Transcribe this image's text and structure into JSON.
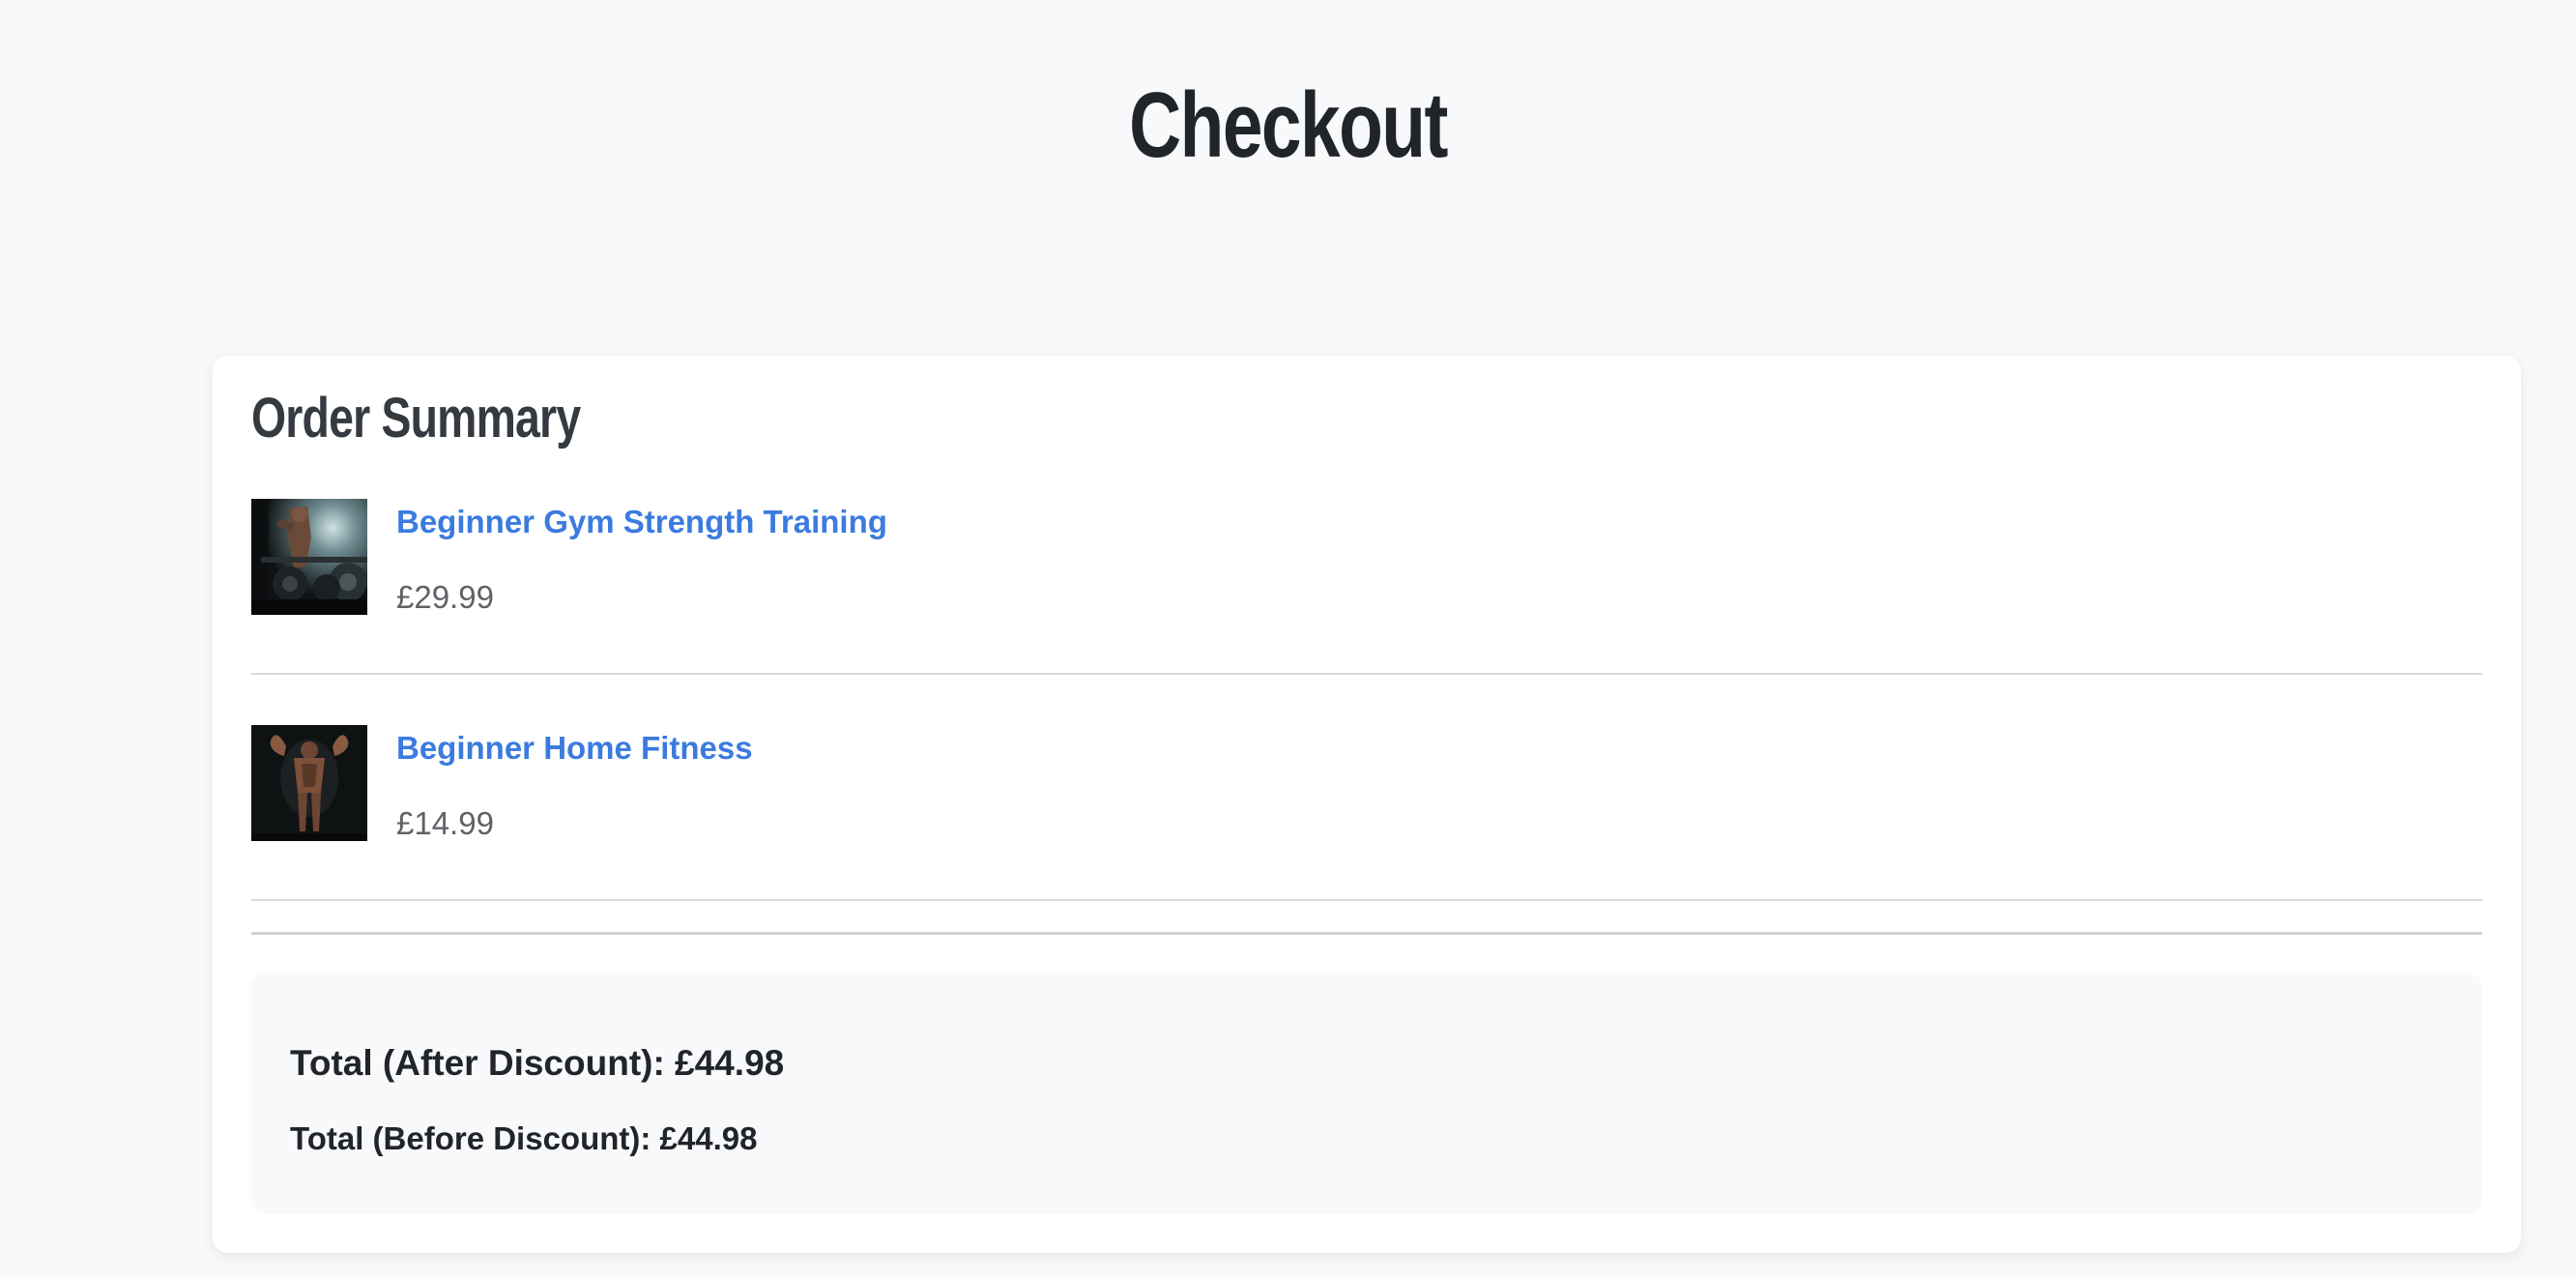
{
  "page": {
    "title": "Checkout"
  },
  "summary": {
    "title": "Order Summary",
    "items": [
      {
        "name": "Beginner Gym Strength Training",
        "price": "£29.99",
        "image": "gym-strength-training-photo"
      },
      {
        "name": "Beginner Home Fitness",
        "price": "£14.99",
        "image": "home-fitness-photo"
      }
    ]
  },
  "totals": {
    "after_discount": "Total (After Discount): £44.98",
    "before_discount": "Total (Before Discount): £44.98"
  },
  "colors": {
    "background": "#f8f9fa",
    "card": "#ffffff",
    "link": "#3b7be0",
    "heading": "#212529",
    "price": "#5f6368"
  }
}
